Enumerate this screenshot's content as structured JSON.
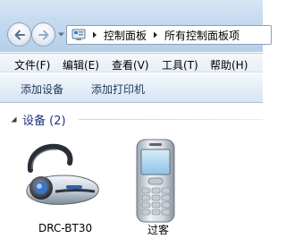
{
  "address": {
    "crumbs": [
      "控制面板",
      "所有控制面板项"
    ]
  },
  "menu": {
    "items": [
      "文件(F)",
      "编辑(E)",
      "查看(V)",
      "工具(T)",
      "帮助(H)"
    ]
  },
  "commands": {
    "add_device": "添加设备",
    "add_printer": "添加打印机"
  },
  "group": {
    "title": "设备 (2)"
  },
  "devices": [
    {
      "label": "DRC-BT30",
      "icon": "bluetooth-headset-icon"
    },
    {
      "label": "过客",
      "icon": "mobile-phone-icon"
    }
  ],
  "colors": {
    "group_title": "#1e3287",
    "command_text": "#1e395b",
    "glass": "#c4d9ef"
  }
}
